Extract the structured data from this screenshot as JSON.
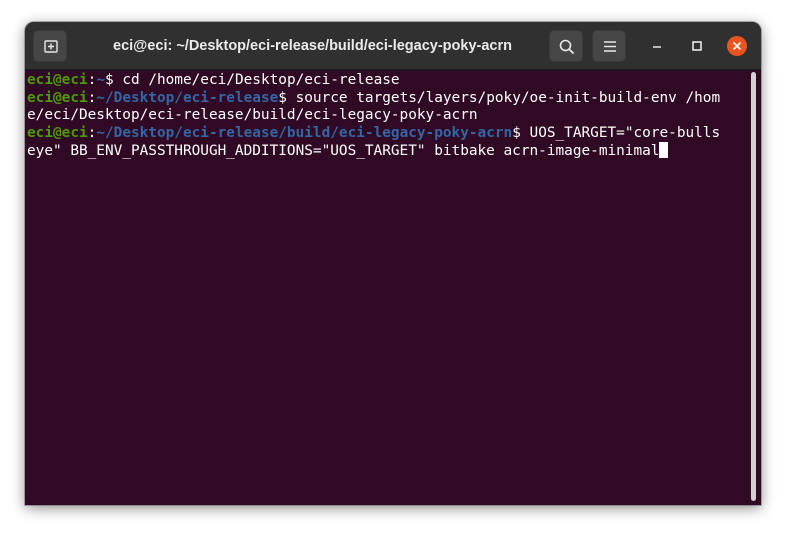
{
  "window": {
    "title": "eci@eci: ~/Desktop/eci-release/build/eci-legacy-poky-acrn"
  },
  "titlebar": {
    "new_tab_icon": "new-tab-icon",
    "search_icon": "search-icon",
    "menu_icon": "hamburger-menu-icon",
    "minimize_icon": "minimize-icon",
    "maximize_icon": "maximize-icon",
    "close_icon": "close-icon"
  },
  "colors": {
    "terminal_bg": "#300a24",
    "prompt_user": "#4e9a06",
    "prompt_path": "#3465a4",
    "text": "#ffffff",
    "titlebar_bg": "#303030",
    "close_button": "#e95420"
  },
  "terminal": {
    "lines": [
      {
        "user": "eci@eci",
        "sep": ":",
        "path": "~",
        "dollar": "$ ",
        "cmd": "cd /home/eci/Desktop/eci-release"
      },
      {
        "user": "eci@eci",
        "sep": ":",
        "path": "~/Desktop/eci-release",
        "dollar": "$ ",
        "cmd": "source targets/layers/poky/oe-init-build-env /hom"
      },
      {
        "text": "e/eci/Desktop/eci-release/build/eci-legacy-poky-acrn"
      },
      {
        "user": "eci@eci",
        "sep": ":",
        "path": "~/Desktop/eci-release/build/eci-legacy-poky-acrn",
        "dollar": "$ ",
        "cmd": "UOS_TARGET=\"core-bulls"
      },
      {
        "text": "eye\" BB_ENV_PASSTHROUGH_ADDITIONS=\"UOS_TARGET\" bitbake acrn-image-minimal"
      }
    ]
  }
}
